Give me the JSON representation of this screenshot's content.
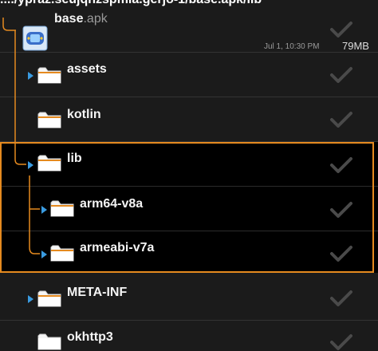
{
  "path_bar": {
    "text": "..../ypraz.seujqnzspmia.gerjo-1/base.apk/lib"
  },
  "apk": {
    "name": "base",
    "ext": ".apk",
    "date": "Jul 1, 10:30 PM",
    "size": "79MB",
    "icon": "android-app-icon"
  },
  "items": [
    {
      "label": "assets"
    },
    {
      "label": "kotlin"
    },
    {
      "label": "lib"
    },
    {
      "label": "arm64-v8a"
    },
    {
      "label": "armeabi-v7a"
    },
    {
      "label": "META-INF"
    },
    {
      "label": "okhttp3"
    }
  ],
  "colors": {
    "tree_line": "#e58a1f",
    "arrow": "#3a9be0",
    "folder": "#f5f5f5",
    "check": "#4a4a4a",
    "selection": "#e58a1f"
  }
}
